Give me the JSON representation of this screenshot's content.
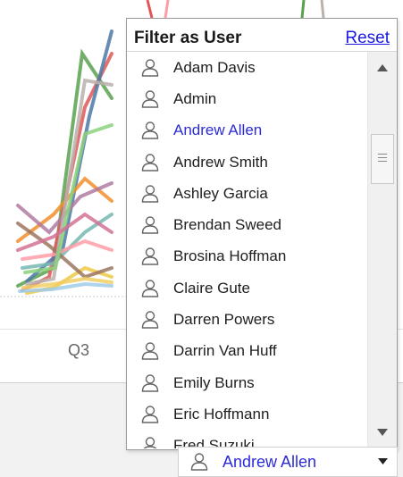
{
  "chart": {
    "quarter_label": "Q3",
    "line_colors": [
      "#59a14f",
      "#e15759",
      "#4e79a7",
      "#f28e2b",
      "#76b7b2",
      "#edc948",
      "#b07aa1",
      "#ff9da7",
      "#9c755f",
      "#bab0ac",
      "#a0cbe8",
      "#8cd17d",
      "#d37295",
      "#f1ce63"
    ]
  },
  "filter_popup": {
    "title": "Filter as User",
    "reset_label": "Reset",
    "selected_color": "#2b2bd9",
    "users": [
      {
        "name": "Adam Davis",
        "selected": false
      },
      {
        "name": "Admin",
        "selected": false
      },
      {
        "name": "Andrew Allen",
        "selected": true
      },
      {
        "name": "Andrew Smith",
        "selected": false
      },
      {
        "name": "Ashley Garcia",
        "selected": false
      },
      {
        "name": "Brendan Sweed",
        "selected": false
      },
      {
        "name": "Brosina Hoffman",
        "selected": false
      },
      {
        "name": "Claire Gute",
        "selected": false
      },
      {
        "name": "Darren Powers",
        "selected": false
      },
      {
        "name": "Darrin Van Huff",
        "selected": false
      },
      {
        "name": "Emily Burns",
        "selected": false
      },
      {
        "name": "Eric Hoffmann",
        "selected": false
      },
      {
        "name": "Fred Suzuki",
        "selected": false
      }
    ]
  },
  "user_selector": {
    "value": "Andrew Allen",
    "icon": "user-icon",
    "caret_icon": "caret-down-icon"
  }
}
